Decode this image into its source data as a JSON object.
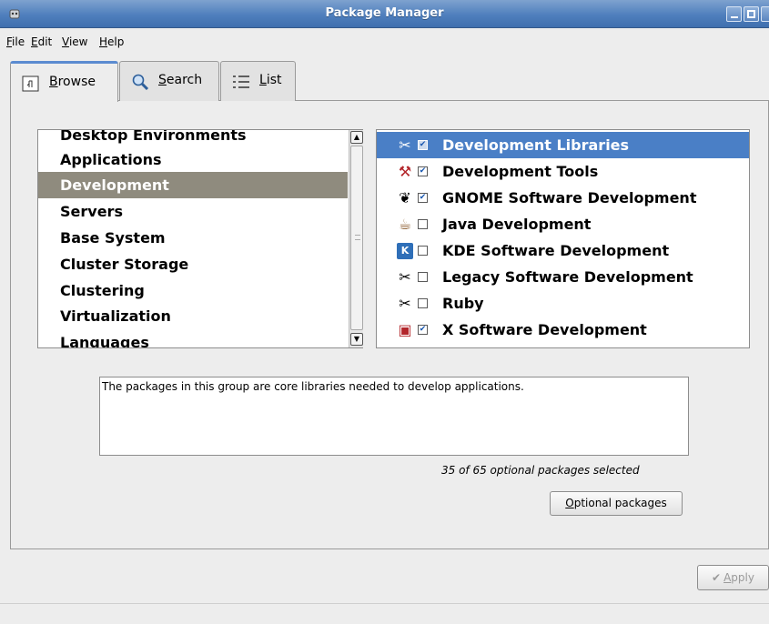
{
  "window": {
    "title": "Package Manager"
  },
  "menu": [
    {
      "label": "File",
      "mnemonic": "F",
      "rest": "ile"
    },
    {
      "label": "Edit",
      "mnemonic": "E",
      "rest": "dit"
    },
    {
      "label": "View",
      "mnemonic": "V",
      "rest": "iew"
    },
    {
      "label": "Help",
      "mnemonic": "H",
      "rest": "elp"
    }
  ],
  "tabs": [
    {
      "label": "Browse",
      "mnemonic": "B",
      "rest": "rowse",
      "icon": "browse-icon",
      "active": true
    },
    {
      "label": "Search",
      "mnemonic": "S",
      "rest": "earch",
      "icon": "search-icon",
      "active": false
    },
    {
      "label": "List",
      "mnemonic": "L",
      "rest": "ist",
      "icon": "list-icon",
      "active": false
    }
  ],
  "categories": {
    "items": [
      "Desktop Environments",
      "Applications",
      "Development",
      "Servers",
      "Base System",
      "Cluster Storage",
      "Clustering",
      "Virtualization",
      "Languages"
    ],
    "selected": "Development"
  },
  "groups": [
    {
      "label": "Development Libraries",
      "icon": "tools-icon",
      "checked": true,
      "selected": true
    },
    {
      "label": "Development Tools",
      "icon": "toolbox-icon",
      "checked": true,
      "selected": false
    },
    {
      "label": "GNOME Software Development",
      "icon": "gnome-foot-icon",
      "checked": true,
      "selected": false
    },
    {
      "label": "Java Development",
      "icon": "coffee-cup-icon",
      "checked": false,
      "selected": false
    },
    {
      "label": "KDE Software Development",
      "icon": "kde-icon",
      "checked": false,
      "selected": false
    },
    {
      "label": "Legacy Software Development",
      "icon": "tools-icon",
      "checked": false,
      "selected": false
    },
    {
      "label": "Ruby",
      "icon": "tools-icon",
      "checked": false,
      "selected": false
    },
    {
      "label": "X Software Development",
      "icon": "x-monitor-icon",
      "checked": true,
      "selected": false
    }
  ],
  "description": "The packages in this group are core libraries needed to develop applications.",
  "count_text": "35 of 65 optional packages selected",
  "buttons": {
    "optional": {
      "mnemonic": "O",
      "rest": "ptional packages"
    },
    "apply": {
      "mnemonic": "A",
      "rest": "pply",
      "enabled": false
    }
  }
}
